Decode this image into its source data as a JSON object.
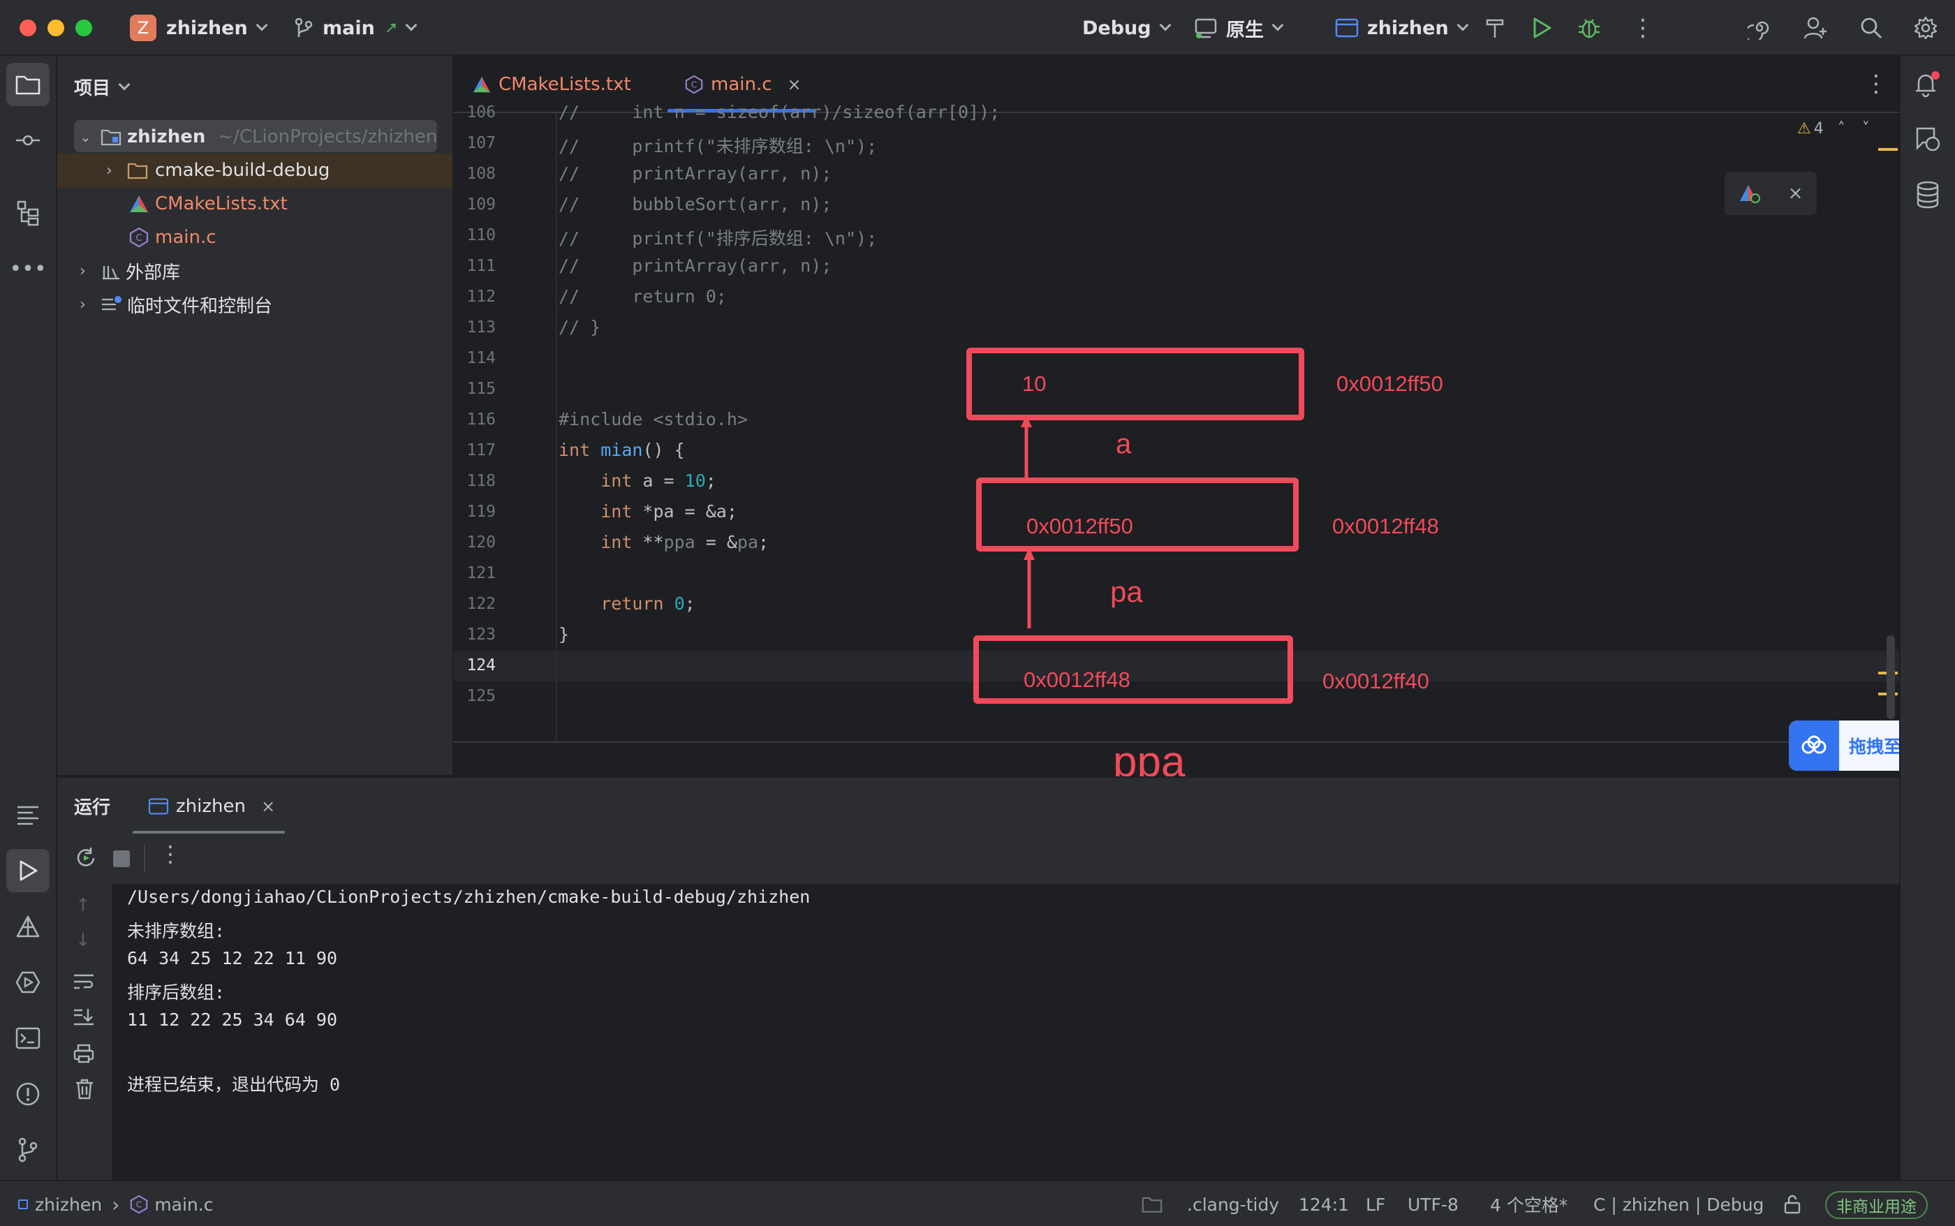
{
  "titlebar": {
    "project_badge": "Z",
    "project_name": "zhizhen",
    "branch": "main",
    "build_config": "Debug",
    "toolchain": "原生",
    "run_target": "zhizhen"
  },
  "project_panel": {
    "title": "项目",
    "tree": [
      {
        "label": "zhizhen",
        "path": "~/CLionProjects/zhizhen"
      },
      {
        "label": "cmake-build-debug"
      },
      {
        "label": "CMakeLists.txt"
      },
      {
        "label": "main.c"
      },
      {
        "label": "外部库"
      },
      {
        "label": "临时文件和控制台"
      }
    ]
  },
  "editor": {
    "tabs": [
      {
        "label": "CMakeLists.txt"
      },
      {
        "label": "main.c"
      }
    ],
    "warnings": "4",
    "line_numbers": [
      "106",
      "107",
      "108",
      "109",
      "110",
      "111",
      "112",
      "113",
      "114",
      "115",
      "116",
      "117",
      "118",
      "119",
      "120",
      "121",
      "122",
      "123",
      "124",
      "125"
    ],
    "code": {
      "l106": "//     int n = sizeof(arr)/sizeof(arr[0]);",
      "l107": "//     printf(\"未排序数组: \\n\");",
      "l108": "//     printArray(arr, n);",
      "l109": "//     bubbleSort(arr, n);",
      "l110": "//     printf(\"排序后数组: \\n\");",
      "l111": "//     printArray(arr, n);",
      "l112": "//     return 0;",
      "l113": "// }",
      "l116_pp": "#include <stdio.h>",
      "l117_kw": "int",
      "l117_fn": "mian",
      "l117_rest": "() {",
      "l118_kw": "int",
      "l118_rest": " a = ",
      "l118_num": "10",
      "l118_end": ";",
      "l119_kw": "int",
      "l119_rest": " *pa = &a;",
      "l120_kw": "int",
      "l120_rest1": " **",
      "l120_var": "ppa",
      "l120_rest2": " = &",
      "l120_pa": "pa",
      "l120_end": ";",
      "l122_kw": "return",
      "l122_num": "0",
      "l122_end": ";",
      "l123": "}"
    }
  },
  "annotation": {
    "box1_value": "10",
    "box1_addr": "0x0012ff50",
    "box1_name": "a",
    "box2_value": "0x0012ff50",
    "box2_addr": "0x0012ff48",
    "box2_name": "pa",
    "box3_value": "0x0012ff48",
    "box3_addr": "0x0012ff40",
    "box3_name": "ppa"
  },
  "upload_badge": "拖拽至此上传",
  "run_panel": {
    "title": "运行",
    "tab": "zhizhen",
    "output": [
      "/Users/dongjiahao/CLionProjects/zhizhen/cmake-build-debug/zhizhen",
      "未排序数组:",
      "64 34 25 12 22 11 90",
      "排序后数组:",
      "11 12 22 25 34 64 90",
      "",
      "进程已结束，退出代码为 0"
    ]
  },
  "statusbar": {
    "crumb_project": "zhizhen",
    "crumb_file": "main.c",
    "linter": ".clang-tidy",
    "position": "124:1",
    "line_sep": "LF",
    "encoding": "UTF-8",
    "indent": "4 个空格*",
    "context": "C | zhizhen | Debug",
    "license": "非商业用途"
  },
  "colors": {
    "accent_blue": "#3574f0",
    "annotation_red": "#f24a5a",
    "run_green": "#5fb865"
  }
}
